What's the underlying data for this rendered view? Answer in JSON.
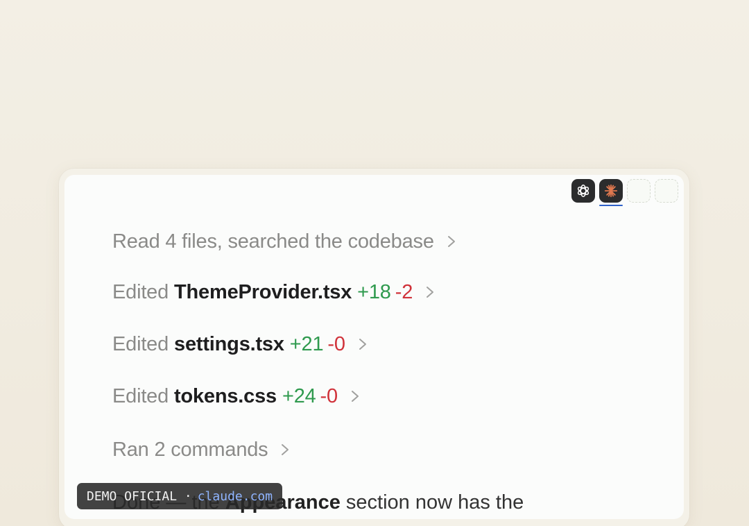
{
  "model_switcher": {
    "models": [
      {
        "icon": "openai-logo-icon",
        "active": false
      },
      {
        "icon": "claude-logo-icon",
        "active": true
      },
      {
        "icon": "empty-slot",
        "active": false
      },
      {
        "icon": "empty-slot",
        "active": false
      }
    ]
  },
  "activity_log": [
    {
      "text": "Read 4 files, searched the codebase"
    },
    {
      "prefix": "Edited",
      "file": "ThemeProvider.tsx",
      "added": "+18",
      "removed": "-2"
    },
    {
      "prefix": "Edited",
      "file": "settings.tsx",
      "added": "+21",
      "removed": "-0"
    },
    {
      "prefix": "Edited",
      "file": "tokens.css",
      "added": "+24",
      "removed": "-0"
    },
    {
      "text": "Ran 2 commands"
    }
  ],
  "summary": {
    "before": "Done — the ",
    "bold": "Appearance",
    "after": " section now has the"
  },
  "watermark": {
    "label": "DEMO OFICIAL ·",
    "domain": "claude.com"
  },
  "colors": {
    "added": "#2f9a4e",
    "removed": "#d0323a",
    "active_underline": "#2f62c9"
  }
}
